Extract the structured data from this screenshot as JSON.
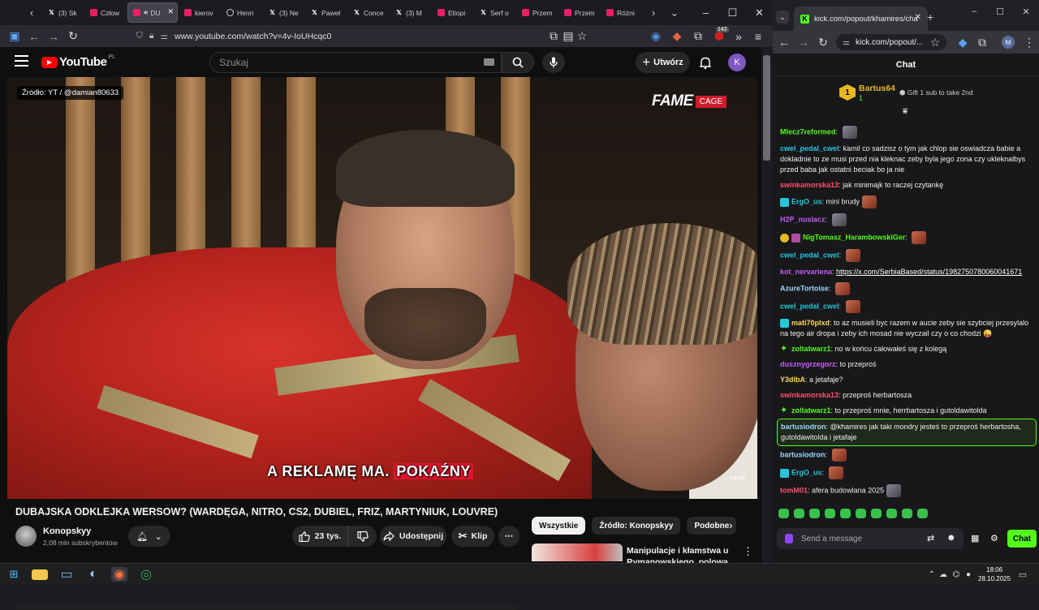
{
  "firefox": {
    "tabs": [
      {
        "label": "(3) Sk",
        "icon": "x"
      },
      {
        "label": "Człow",
        "icon": "yt"
      },
      {
        "label": "DU",
        "icon": "yt",
        "active": true
      },
      {
        "label": "kierov",
        "icon": "yt"
      },
      {
        "label": "Henri",
        "icon": "g"
      },
      {
        "label": "(3) Ne",
        "icon": "x"
      },
      {
        "label": "Paweł",
        "icon": "x"
      },
      {
        "label": "Conce",
        "icon": "x"
      },
      {
        "label": "(3) M",
        "icon": "x"
      },
      {
        "label": "Etiopi",
        "icon": "yt"
      },
      {
        "label": "Serf o",
        "icon": "x"
      },
      {
        "label": "Przem",
        "icon": "yt"
      },
      {
        "label": "Przem",
        "icon": "yt"
      },
      {
        "label": "Różni",
        "icon": "yt"
      }
    ],
    "url": "www.youtube.com/watch?v=4v-IoUHcqc0",
    "badge_count": "142"
  },
  "youtube": {
    "logo": "YouTube",
    "country": "PL",
    "search_placeholder": "Szukaj",
    "create_label": "Utwórz",
    "avatar_letter": "K",
    "video": {
      "source_badge": "Źródło: YT / @damian80633",
      "fame_logo": "FAME",
      "fame_tag": "CAGE",
      "watermark": "FAME",
      "subtitle_pre": "A REKLAMĘ MA.",
      "subtitle_hl": "POKAŹNY"
    },
    "title": "DUBAJSKA ODKLEJKA WERSOW? (WARDĘGA, NITRO, CS2, DUBIEL, FRIZ, MARTYNIUK, LOUVRE)",
    "channel": {
      "name": "Konopskyy",
      "subs": "2,08 mln subskrybentów"
    },
    "actions": {
      "likes": "23 tys.",
      "share": "Udostępnij",
      "clip": "Klip"
    },
    "chips": [
      "Wszystkie",
      "Źródło: Konopskyy",
      "Podobne"
    ],
    "recommended": {
      "title": "Manipulacje i kłamstwa u Rymanowskiego, polowa"
    }
  },
  "chrome": {
    "tab_title": "kick.com/popout/khamires/cha",
    "url": "kick.com/popout/...",
    "profile": "M"
  },
  "chat": {
    "header": "Chat",
    "pinned": {
      "name": "Bartus64",
      "count": "1",
      "gift_text": "Gift 1 sub to take 2nd",
      "badge": "1"
    },
    "messages": [
      {
        "user": "Mlecz7reformed",
        "color": "#53fc18",
        "text": "",
        "emote": "g"
      },
      {
        "user": "cwel_pedal_cwel",
        "color": "#26c6da",
        "text": "kamil co sadzisz o tym jak chlop sie oswiadcza babie a dokladnie to ze musi przed nia kleknac zeby byla jego zona czy ukleknalbys przed baba jak ostatni beciak bo ja nie"
      },
      {
        "user": "swinkamorska13",
        "color": "#ff4f6a",
        "text": "jak minimajk to raczej czytankę"
      },
      {
        "user": "ErgO_us",
        "color": "#26c6da",
        "text": "mini brudy",
        "badge": "c",
        "emote": "r"
      },
      {
        "user": "H2P_nusiacz",
        "color": "#c45cf6",
        "text": "",
        "emote": "g"
      },
      {
        "user": "NigTomasz_HarambowskiGer",
        "color": "#53fc18",
        "text": "",
        "badge": "y",
        "badge2": "v",
        "emote": "r"
      },
      {
        "user": "cwel_pedal_cwel",
        "color": "#26c6da",
        "text": "",
        "emote": "r"
      },
      {
        "user": "kot_nervariena",
        "color": "#c45cf6",
        "text": "",
        "link": "https://x.com/SerbiaBased/status/1982750780060041671"
      },
      {
        "user": "AzureTortoise",
        "color": "#9ad8ff",
        "text": "",
        "emote": "r"
      },
      {
        "user": "cwel_pedal_cwel",
        "color": "#26c6da",
        "text": "",
        "emote": "r"
      },
      {
        "user": "mati70plxd",
        "color": "#ffd54f",
        "text": "to az musieli byc razem w aucie zeby sie szybciej przesylalo na tego air dropa i zeby ich mosad nie wyczail czy o co chodzi 😜",
        "badge": "c"
      },
      {
        "user": "zoltatwarz1",
        "color": "#53fc18",
        "text": "no w końcu całowałeś się z kolegą",
        "badge": "g"
      },
      {
        "user": "dusznygrzegorz",
        "color": "#c45cf6",
        "text": "to przeproś"
      },
      {
        "user": "Y3dlbA",
        "color": "#ffd54f",
        "text": "a jetafaje?"
      },
      {
        "user": "swinkamorska13",
        "color": "#ff4f6a",
        "text": "przeproś herbartosza"
      },
      {
        "user": "zoltatwarz1",
        "color": "#53fc18",
        "text": "to przeproś mnie, herrbartosza i gutoldawitolda",
        "badge": "g"
      },
      {
        "user": "bartusiodron",
        "color": "#9ad8ff",
        "text": "@khamires jak taki mondry jesteś to przeproś herbartosha, gutoldawitolda i jetafaje",
        "highlight": true
      },
      {
        "user": "bartusiodron",
        "color": "#9ad8ff",
        "text": "",
        "emote": "r"
      },
      {
        "user": "ErgO_us",
        "color": "#26c6da",
        "text": "",
        "badge": "c",
        "emote": "r"
      },
      {
        "user": "tomM01",
        "color": "#ff4f6a",
        "text": "afera budowlana 2025",
        "emote": "g"
      }
    ],
    "input_placeholder": "Send a message",
    "send_label": "Chat"
  },
  "taskbar": {
    "time": "18:06",
    "date": "28.10.2025"
  }
}
